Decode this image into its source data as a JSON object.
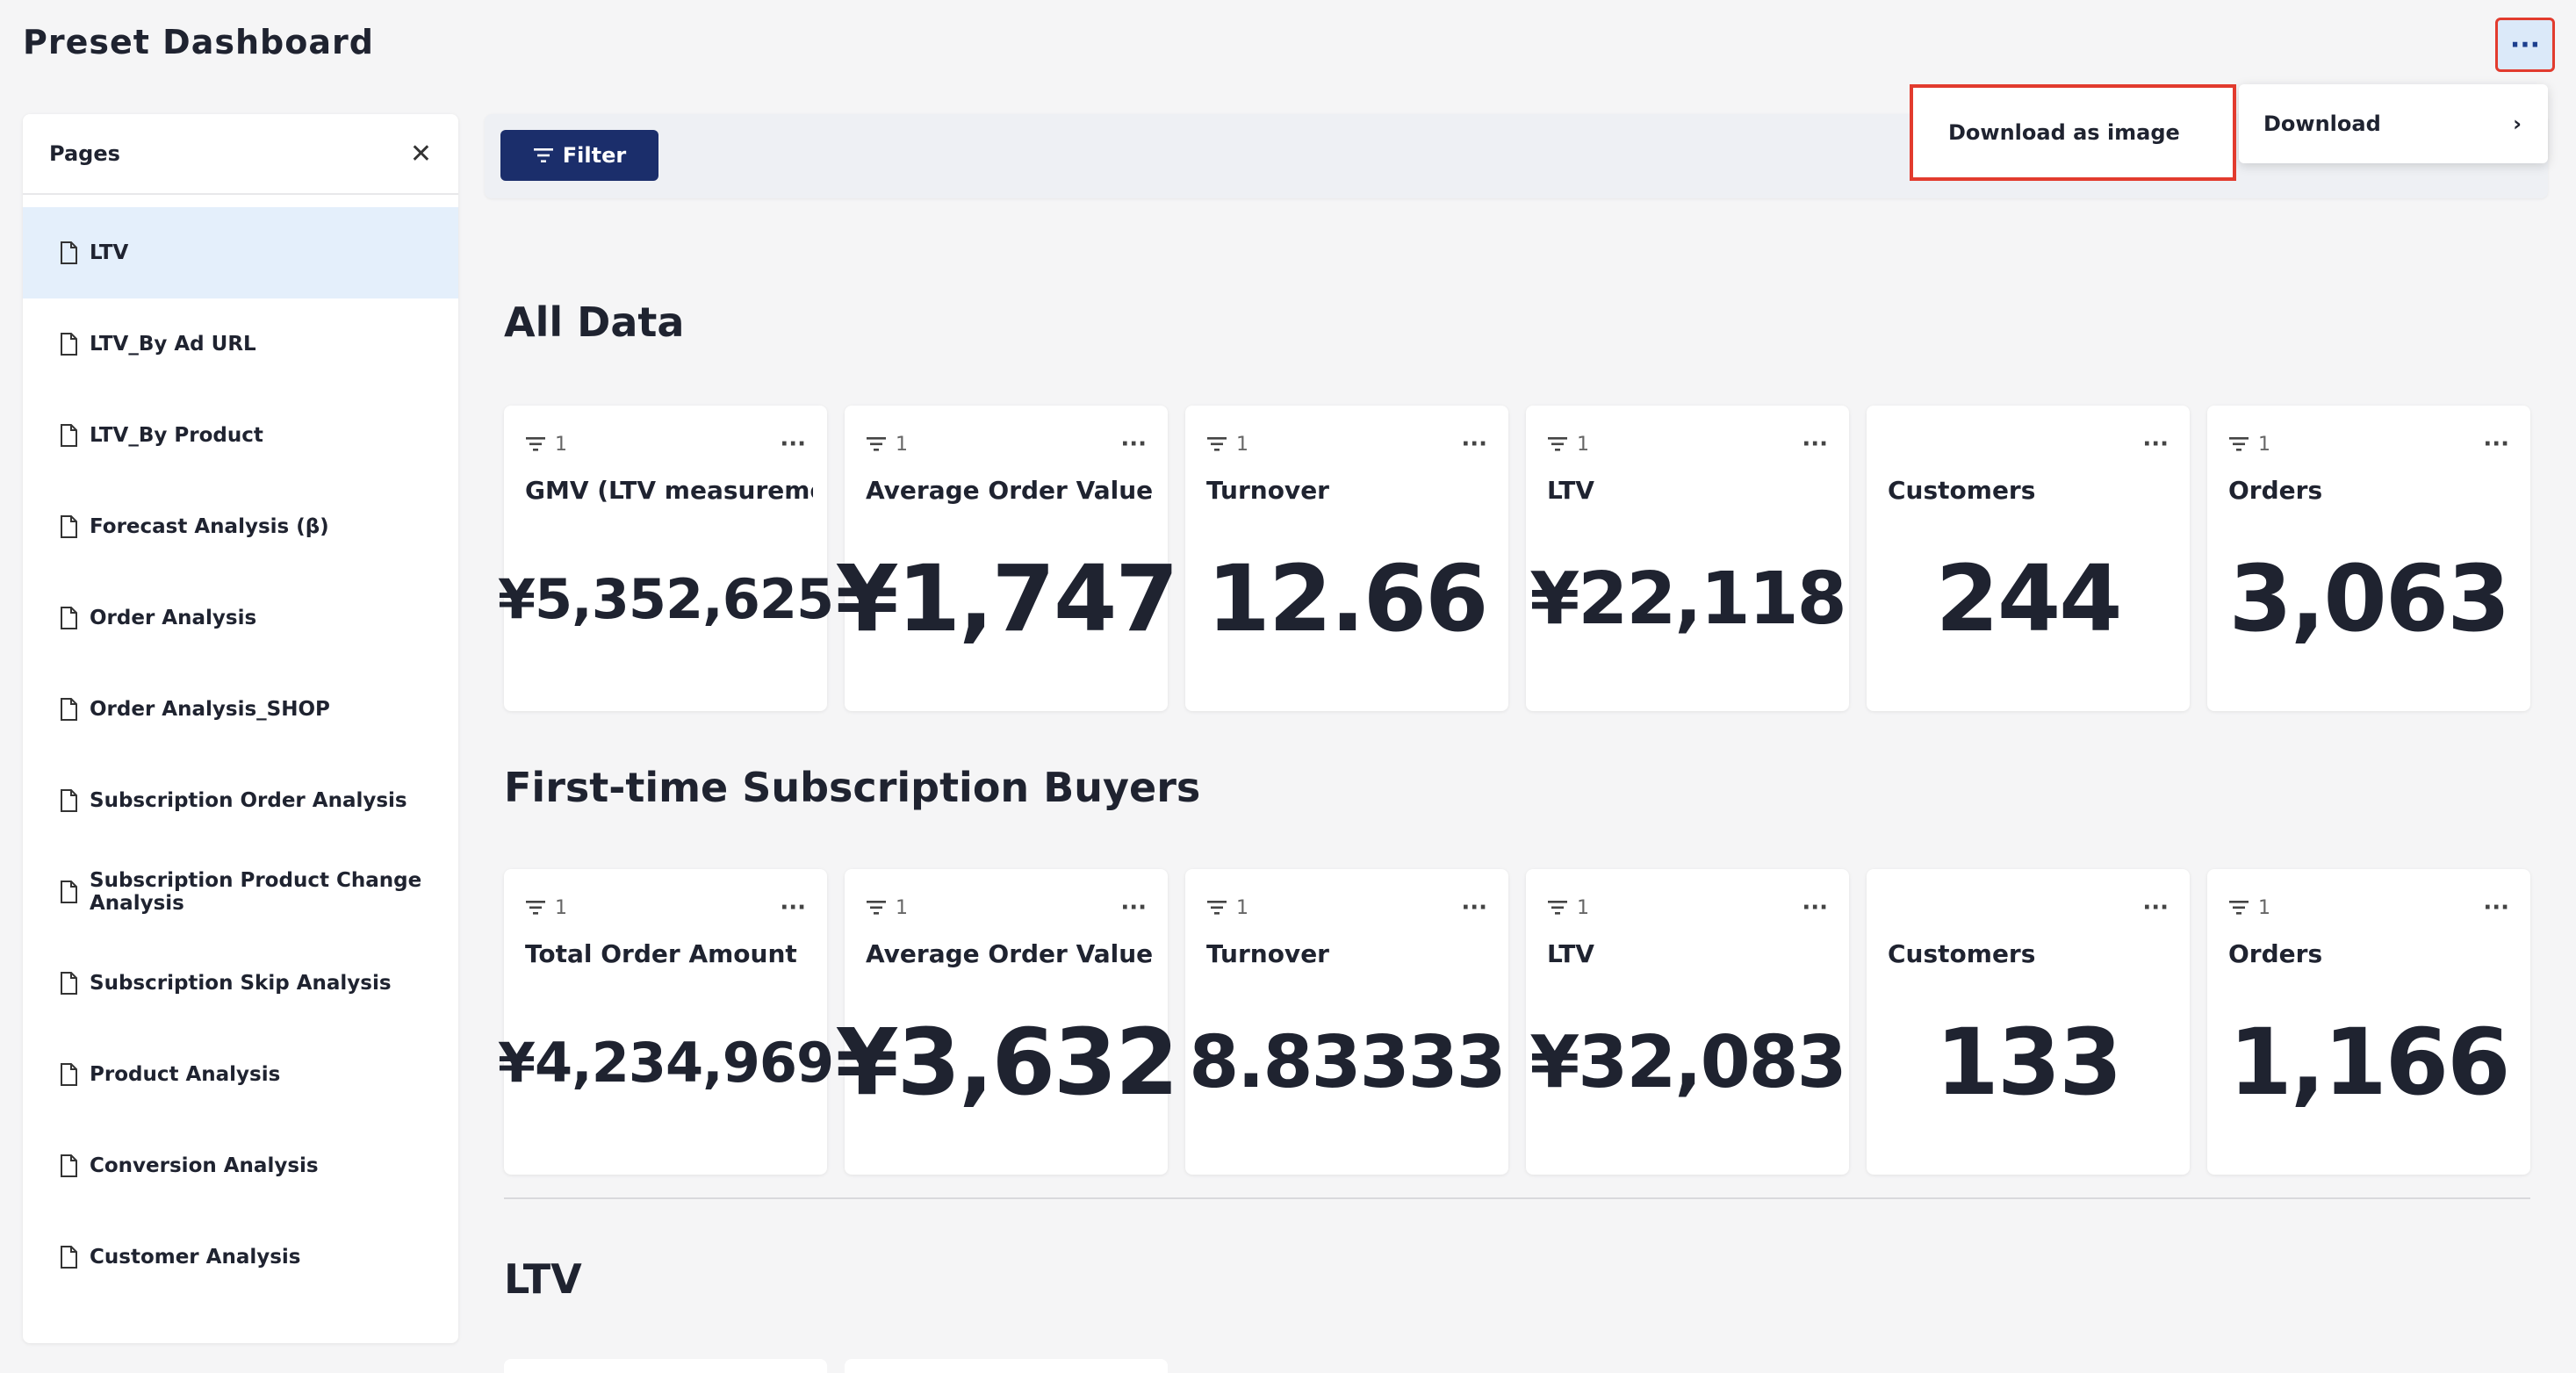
{
  "header": {
    "title": "Preset Dashboard",
    "menu_label": "···"
  },
  "sidebar": {
    "title": "Pages",
    "items": [
      {
        "label": "LTV"
      },
      {
        "label": "LTV_By Ad URL"
      },
      {
        "label": "LTV_By Product"
      },
      {
        "label": "Forecast Analysis (β)"
      },
      {
        "label": "Order Analysis"
      },
      {
        "label": "Order Analysis_SHOP"
      },
      {
        "label": "Subscription Order Analysis"
      },
      {
        "label": "Subscription Product Change Analysis"
      },
      {
        "label": "Subscription Skip Analysis"
      },
      {
        "label": "Product Analysis"
      },
      {
        "label": "Conversion Analysis"
      },
      {
        "label": "Customer Analysis"
      }
    ]
  },
  "filter": {
    "label": "Filter"
  },
  "menu": {
    "download_label": "Download",
    "download_chevron": "›",
    "image_download_label": "Download as image"
  },
  "sections": [
    {
      "title": "All Data",
      "cards": [
        {
          "filter_count": "1",
          "label": "GMV (LTV measurement target)",
          "value": "¥5,352,625"
        },
        {
          "filter_count": "1",
          "label": "Average Order Value",
          "value": "¥1,747"
        },
        {
          "filter_count": "1",
          "label": "Turnover",
          "value": "12.66"
        },
        {
          "filter_count": "1",
          "label": "LTV",
          "value": "¥22,118"
        },
        {
          "filter_count": "",
          "label": "Customers",
          "value": "244"
        },
        {
          "filter_count": "1",
          "label": "Orders",
          "value": "3,063"
        }
      ]
    },
    {
      "title": "First-time Subscription Buyers",
      "cards": [
        {
          "filter_count": "1",
          "label": "Total Order Amount",
          "value": "¥4,234,969"
        },
        {
          "filter_count": "1",
          "label": "Average Order Value",
          "value": "¥3,632"
        },
        {
          "filter_count": "1",
          "label": "Turnover",
          "value": "8.83333"
        },
        {
          "filter_count": "1",
          "label": "LTV",
          "value": "¥32,083"
        },
        {
          "filter_count": "",
          "label": "Customers",
          "value": "133"
        },
        {
          "filter_count": "1",
          "label": "Orders",
          "value": "1,166"
        }
      ]
    },
    {
      "title": "LTV"
    }
  ],
  "colors": {
    "accent": "#1b2e6b",
    "highlight": "#e23b2e",
    "active_row": "#e4effb"
  },
  "icons": {
    "page": "document-icon",
    "filter": "filter-icon",
    "close": "close-icon",
    "more": "more-icon"
  }
}
